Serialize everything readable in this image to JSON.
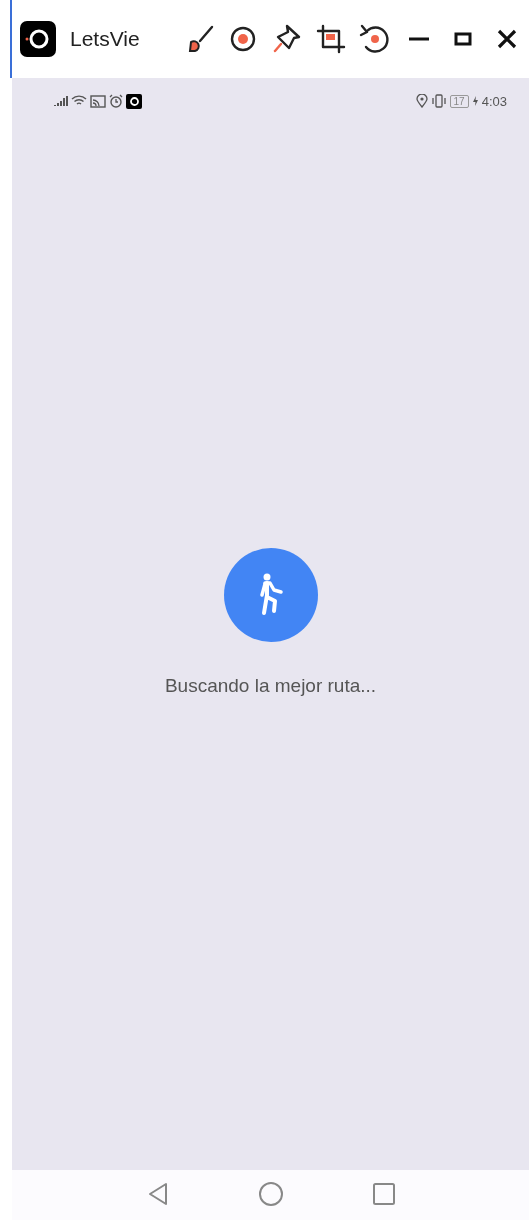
{
  "window": {
    "title": "LetsVie"
  },
  "status_bar": {
    "battery": "17",
    "time": "4:03"
  },
  "loading": {
    "message": "Buscando la mejor ruta..."
  }
}
